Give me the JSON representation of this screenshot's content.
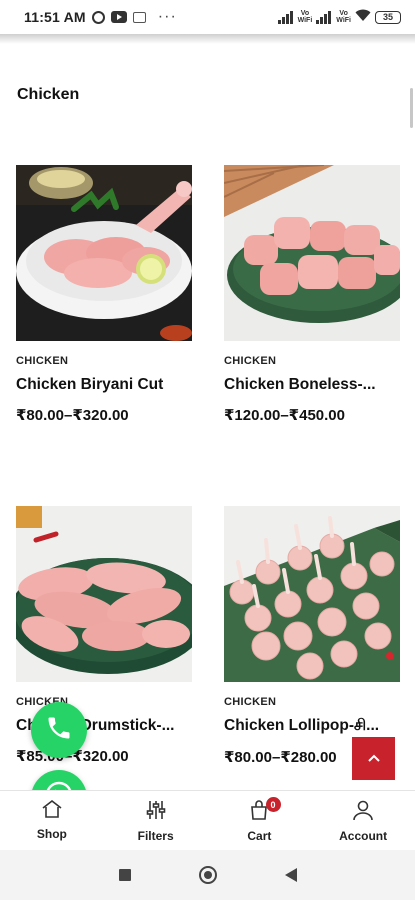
{
  "status_bar": {
    "time": "11:51 AM",
    "more": "···",
    "volte_1": "Vo\nWiFi",
    "volte_2": "Vo\nWiFi",
    "battery": "35"
  },
  "category_title": "Chicken",
  "products": [
    {
      "category": "CHICKEN",
      "name": "Chicken Biryani Cut",
      "price": "₹80.00–₹320.00"
    },
    {
      "category": "CHICKEN",
      "name": "Chicken Boneless-...",
      "price": "₹120.00–₹450.00"
    },
    {
      "category": "CHICKEN",
      "name": "Chicken Drumstick-...",
      "price": "₹85.00–₹320.00"
    },
    {
      "category": "CHICKEN",
      "name": "Chicken Lollipop-சி...",
      "price": "₹80.00–₹280.00"
    }
  ],
  "bottom_nav": {
    "shop": "Shop",
    "filters": "Filters",
    "cart": "Cart",
    "cart_count": "0",
    "account": "Account"
  },
  "colors": {
    "accent_red": "#c8232c",
    "whatsapp_green": "#25d366"
  },
  "icons": [
    "alarm-icon",
    "youtube-icon",
    "message-icon",
    "signal-icon",
    "wifi-icon",
    "battery-icon",
    "phone-icon",
    "whatsapp-icon",
    "chevron-up-icon",
    "shop-icon",
    "filters-icon",
    "cart-icon",
    "account-icon"
  ]
}
